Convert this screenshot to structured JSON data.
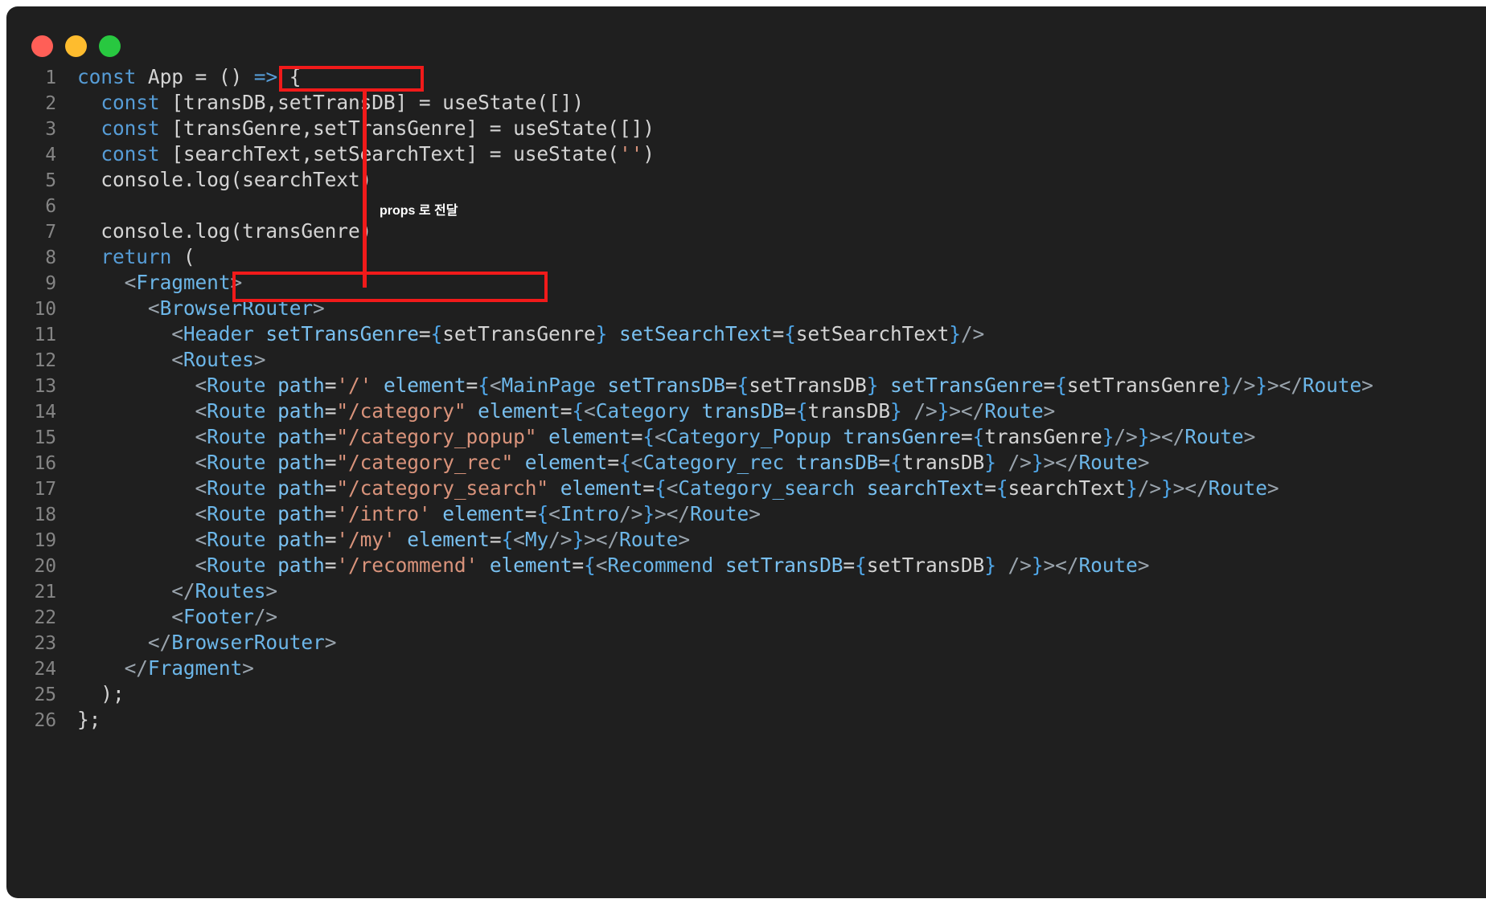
{
  "window": {
    "background": "#1f1f1f",
    "page_background": "#ffffff",
    "traffic_lights": [
      {
        "name": "close",
        "color": "#ff5f57"
      },
      {
        "name": "minimize",
        "color": "#febc2e"
      },
      {
        "name": "maximize",
        "color": "#28c840"
      }
    ]
  },
  "theme": {
    "keyword": "#569cd6",
    "tag": "#6cb6e8",
    "angle": "#9aa4ad",
    "attribute": "#79c0f0",
    "string": "#d9937b",
    "brace": "#4fa6e8",
    "plain": "#d4d4d4",
    "line_number": "#858585",
    "highlight": "#f11a1a"
  },
  "editor": {
    "language": "jsx",
    "line_numbers": [
      "1",
      "2",
      "3",
      "4",
      "5",
      "6",
      "7",
      "8",
      "9",
      "10",
      "11",
      "12",
      "13",
      "14",
      "15",
      "16",
      "17",
      "18",
      "19",
      "20",
      "21",
      "22",
      "23",
      "24",
      "25",
      "26"
    ],
    "lines": [
      {
        "n": "1",
        "text": "const App = () => {"
      },
      {
        "n": "2",
        "text": "  const [transDB,setTransDB] = useState([])"
      },
      {
        "n": "3",
        "text": "  const [transGenre,setTransGenre] = useState([])"
      },
      {
        "n": "4",
        "text": "  const [searchText,setSearchText] = useState('')"
      },
      {
        "n": "5",
        "text": "  console.log(searchText)"
      },
      {
        "n": "6",
        "text": ""
      },
      {
        "n": "7",
        "text": "  console.log(transGenre)"
      },
      {
        "n": "8",
        "text": "  return ("
      },
      {
        "n": "9",
        "text": "    <Fragment>"
      },
      {
        "n": "10",
        "text": "      <BrowserRouter>"
      },
      {
        "n": "11",
        "text": "        <Header setTransGenre={setTransGenre} setSearchText={setSearchText}/>"
      },
      {
        "n": "12",
        "text": "        <Routes>"
      },
      {
        "n": "13",
        "text": "          <Route path='/' element={<MainPage setTransDB={setTransDB} setTransGenre={setTransGenre}/>}></Route>"
      },
      {
        "n": "14",
        "text": "          <Route path=\"/category\" element={<Category transDB={transDB} />}></Route>"
      },
      {
        "n": "15",
        "text": "          <Route path=\"/category_popup\" element={<Category_Popup transGenre={transGenre}/>}></Route>"
      },
      {
        "n": "16",
        "text": "          <Route path=\"/category_rec\" element={<Category_rec transDB={transDB} />}></Route>"
      },
      {
        "n": "17",
        "text": "          <Route path=\"/category_search\" element={<Category_search searchText={searchText}/>}></Route>"
      },
      {
        "n": "18",
        "text": "          <Route path='/intro' element={<Intro/>}></Route>"
      },
      {
        "n": "19",
        "text": "          <Route path='/my' element={<My/>}></Route>"
      },
      {
        "n": "20",
        "text": "          <Route path='/recommend' element={<Recommend setTransDB={setTransDB} />}></Route>"
      },
      {
        "n": "21",
        "text": "        </Routes>"
      },
      {
        "n": "22",
        "text": "        <Footer/>"
      },
      {
        "n": "23",
        "text": "      </BrowserRouter>"
      },
      {
        "n": "24",
        "text": "    </Fragment>"
      },
      {
        "n": "25",
        "text": "  );"
      },
      {
        "n": "26",
        "text": "};"
      }
    ]
  },
  "annotations": {
    "source_highlight_label": "setTransGenre",
    "target_highlight_label": "setTransGenre={setTransGenre}",
    "note": "props 로 전달"
  }
}
